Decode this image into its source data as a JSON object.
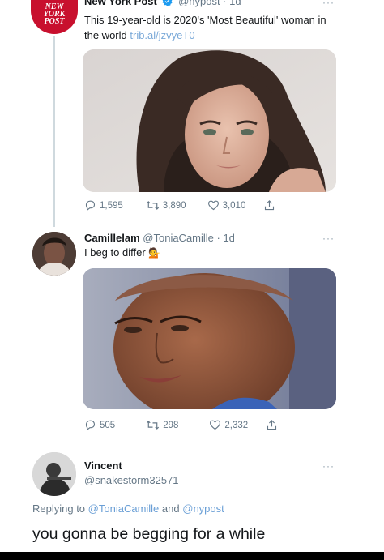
{
  "tweet1": {
    "logo_text": "NEW YORK POST",
    "display_name": "New York Post",
    "handle_time": "@nypost · 1d",
    "more": "···",
    "text": "This 19-year-old is 2020's 'Most Beautiful' woman in the world",
    "link": "trib.al/jzvyeT0",
    "replies": "1,595",
    "retweets": "3,890",
    "likes": "3,010"
  },
  "tweet2": {
    "display_name": "Camillelam",
    "handle_time": "@ToniaCamille · 1d",
    "more": "···",
    "text": "I beg to differ",
    "emoji": "💁",
    "replies": "505",
    "retweets": "298",
    "likes": "2,332"
  },
  "tweet3": {
    "display_name": "Vincent",
    "handle": "@snakestorm32571",
    "more": "···",
    "replying_prefix": "Replying to",
    "replying_mention1": "@ToniaCamille",
    "replying_and": "and",
    "replying_mention2": "@nypost",
    "text": "you gonna be begging for a while"
  },
  "colors": {
    "nypost_red": "#c8102e",
    "mention_blue": "#6a9fd6",
    "muted_gray": "#657786",
    "verified_blue": "#1d9bf0"
  }
}
